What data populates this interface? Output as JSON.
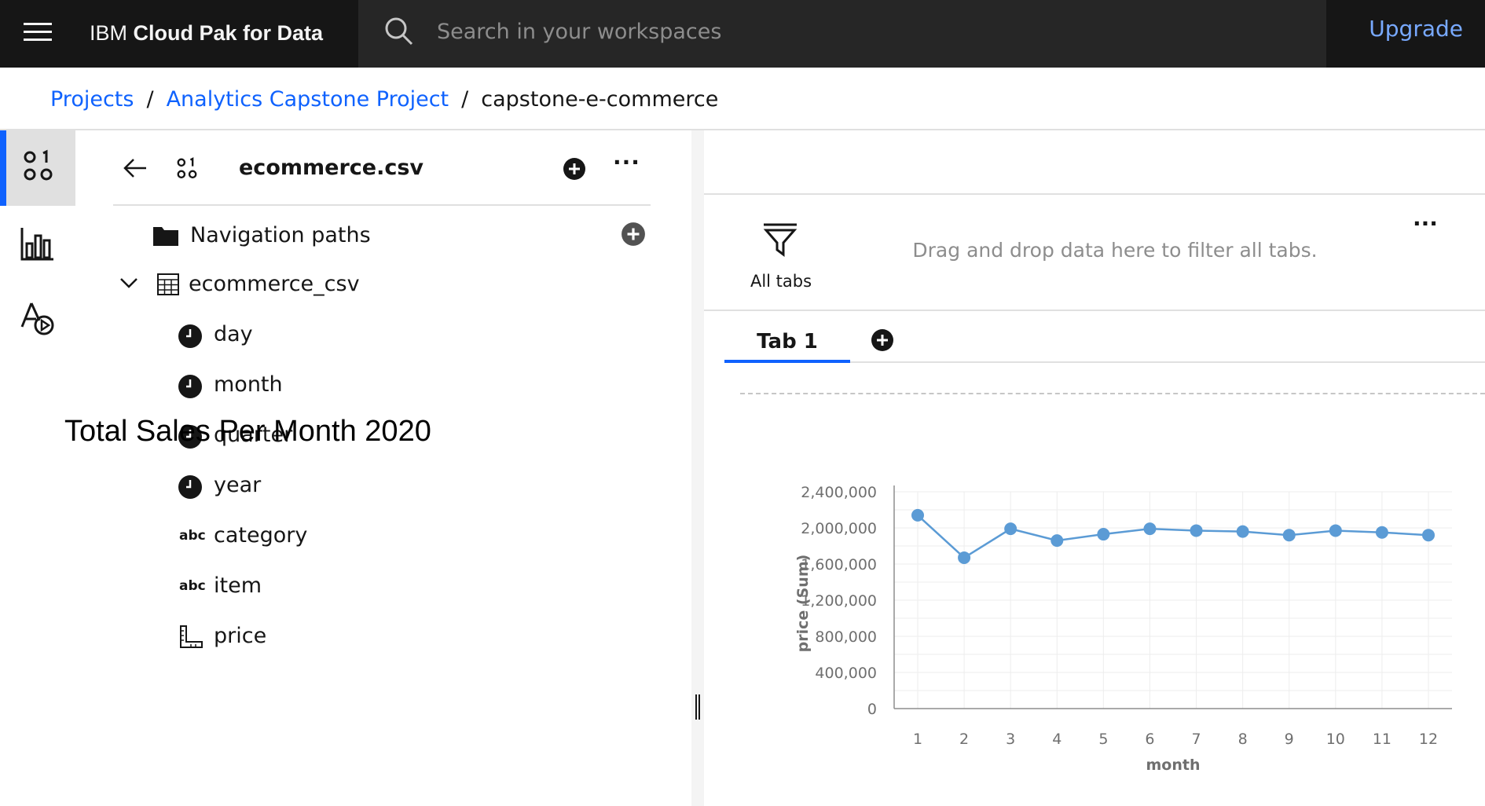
{
  "header": {
    "brand_prefix": "IBM",
    "brand_name": "Cloud Pak for Data",
    "search_placeholder": "Search in your workspaces",
    "upgrade_label": "Upgrade"
  },
  "breadcrumb": {
    "items": [
      "Projects",
      "Analytics Capstone Project",
      "capstone-e-commerce"
    ],
    "separator": "/"
  },
  "rail": {
    "items": [
      {
        "icon": "data-sources-icon",
        "active": true
      },
      {
        "icon": "visualizations-icon",
        "active": false
      },
      {
        "icon": "assistant-icon",
        "active": false
      }
    ]
  },
  "data_panel": {
    "title": "ecommerce.csv",
    "more_label": "···",
    "navigation_paths": "Navigation paths",
    "table_name": "ecommerce_csv",
    "fields": [
      {
        "label": "day",
        "icon": "time-icon"
      },
      {
        "label": "month",
        "icon": "time-icon"
      },
      {
        "label": "quarter",
        "icon": "time-icon"
      },
      {
        "label": "year",
        "icon": "time-icon"
      },
      {
        "label": "category",
        "icon": "text-field-icon"
      },
      {
        "label": "item",
        "icon": "text-field-icon"
      },
      {
        "label": "price",
        "icon": "measure-icon"
      }
    ],
    "abc": "abc"
  },
  "filter_bar": {
    "label": "All tabs",
    "hint": "Drag and drop data here to filter all tabs.",
    "more_label": "···"
  },
  "tabs": {
    "items": [
      "Tab 1"
    ]
  },
  "chart_data": {
    "type": "line",
    "title": "Total Sales Per Month 2020",
    "xlabel": "month",
    "ylabel": "price (Sum)",
    "x": [
      "1",
      "2",
      "3",
      "4",
      "5",
      "6",
      "7",
      "8",
      "9",
      "10",
      "11",
      "12"
    ],
    "values": [
      2140000,
      1670000,
      1990000,
      1860000,
      1930000,
      1990000,
      1970000,
      1960000,
      1920000,
      1970000,
      1950000,
      1920000
    ],
    "ylim": [
      0,
      2400000
    ],
    "yticks": [
      "0",
      "400,000",
      "800,000",
      "1,200,000",
      "1,600,000",
      "2,000,000",
      "2,400,000"
    ],
    "grid": true,
    "color": "#5b9bd5"
  }
}
